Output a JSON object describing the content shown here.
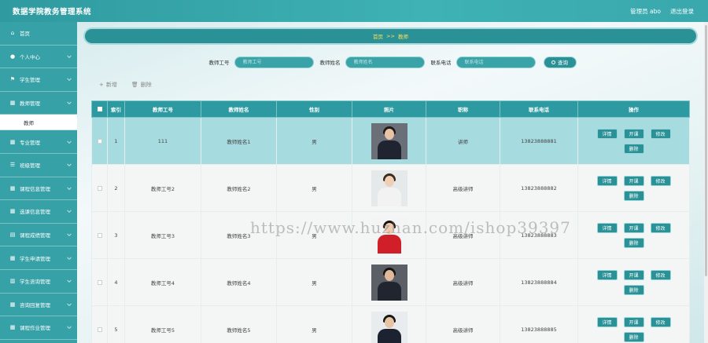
{
  "app": {
    "title": "数据学院教务管理系统"
  },
  "header": {
    "admin_label": "管理员 abo",
    "logout_label": "退出登录"
  },
  "sidebar": {
    "items": [
      {
        "label": "首页",
        "icon": "home-icon",
        "glyph": "⌂"
      },
      {
        "label": "个人中心",
        "icon": "user-icon",
        "glyph": "●"
      },
      {
        "label": "学生管理",
        "icon": "flag-icon",
        "glyph": "⚑"
      },
      {
        "label": "教师管理",
        "icon": "grid-icon",
        "glyph": "▦"
      },
      {
        "label": "专业管理",
        "icon": "grid-icon",
        "glyph": "▦"
      },
      {
        "label": "班级管理",
        "icon": "list-icon",
        "glyph": "☰"
      },
      {
        "label": "课程信息管理",
        "icon": "grid-icon",
        "glyph": "▦"
      },
      {
        "label": "选课信息管理",
        "icon": "grid-icon",
        "glyph": "▦"
      },
      {
        "label": "课程成绩管理",
        "icon": "bank-icon",
        "glyph": "▤"
      },
      {
        "label": "学生申请管理",
        "icon": "grid-icon",
        "glyph": "▦"
      },
      {
        "label": "学生咨询管理",
        "icon": "book-icon",
        "glyph": "▥"
      },
      {
        "label": "咨询回复管理",
        "icon": "grid-icon",
        "glyph": "▦"
      },
      {
        "label": "课程作业管理",
        "icon": "grid-icon",
        "glyph": "▦"
      }
    ],
    "sub_item": "教师"
  },
  "breadcrumb": {
    "home": "首页",
    "sep": ">>",
    "current": "教师"
  },
  "search": {
    "teacher_no_label": "教师工号",
    "teacher_no_placeholder": "教师工号",
    "teacher_name_label": "教师姓名",
    "teacher_name_placeholder": "教师姓名",
    "phone_label": "联系电话",
    "phone_placeholder": "联系电话",
    "button": "查询"
  },
  "actions": {
    "add": "新增",
    "delete": "删除",
    "add_glyph": "+",
    "delete_glyph": "🗑"
  },
  "table": {
    "headers": [
      "索引",
      "教师工号",
      "教师姓名",
      "性别",
      "照片",
      "职称",
      "联系电话",
      "操作"
    ],
    "rows": [
      {
        "index": "1",
        "no": "111",
        "name": "教师姓名1",
        "gender": "男",
        "title": "讲师",
        "phone": "13823888881"
      },
      {
        "index": "2",
        "no": "教师工号2",
        "name": "教师姓名2",
        "gender": "男",
        "title": "高级讲师",
        "phone": "13823888882"
      },
      {
        "index": "3",
        "no": "教师工号3",
        "name": "教师姓名3",
        "gender": "男",
        "title": "高级讲师",
        "phone": "13823888883"
      },
      {
        "index": "4",
        "no": "教师工号4",
        "name": "教师姓名4",
        "gender": "男",
        "title": "高级讲师",
        "phone": "13823888884"
      },
      {
        "index": "5",
        "no": "教师工号5",
        "name": "教师姓名5",
        "gender": "男",
        "title": "高级讲师",
        "phone": "13823888885"
      }
    ],
    "op_labels": {
      "detail": "详情",
      "open": "开课",
      "edit": "修改",
      "delete": "删除"
    }
  },
  "watermark": "https://www.huzhan.com/ishop39397",
  "colors": {
    "accent": "#2a9196",
    "header": "#36a1a6",
    "selected_row": "#a6dbdf",
    "crumb_text": "#ffe05c"
  }
}
